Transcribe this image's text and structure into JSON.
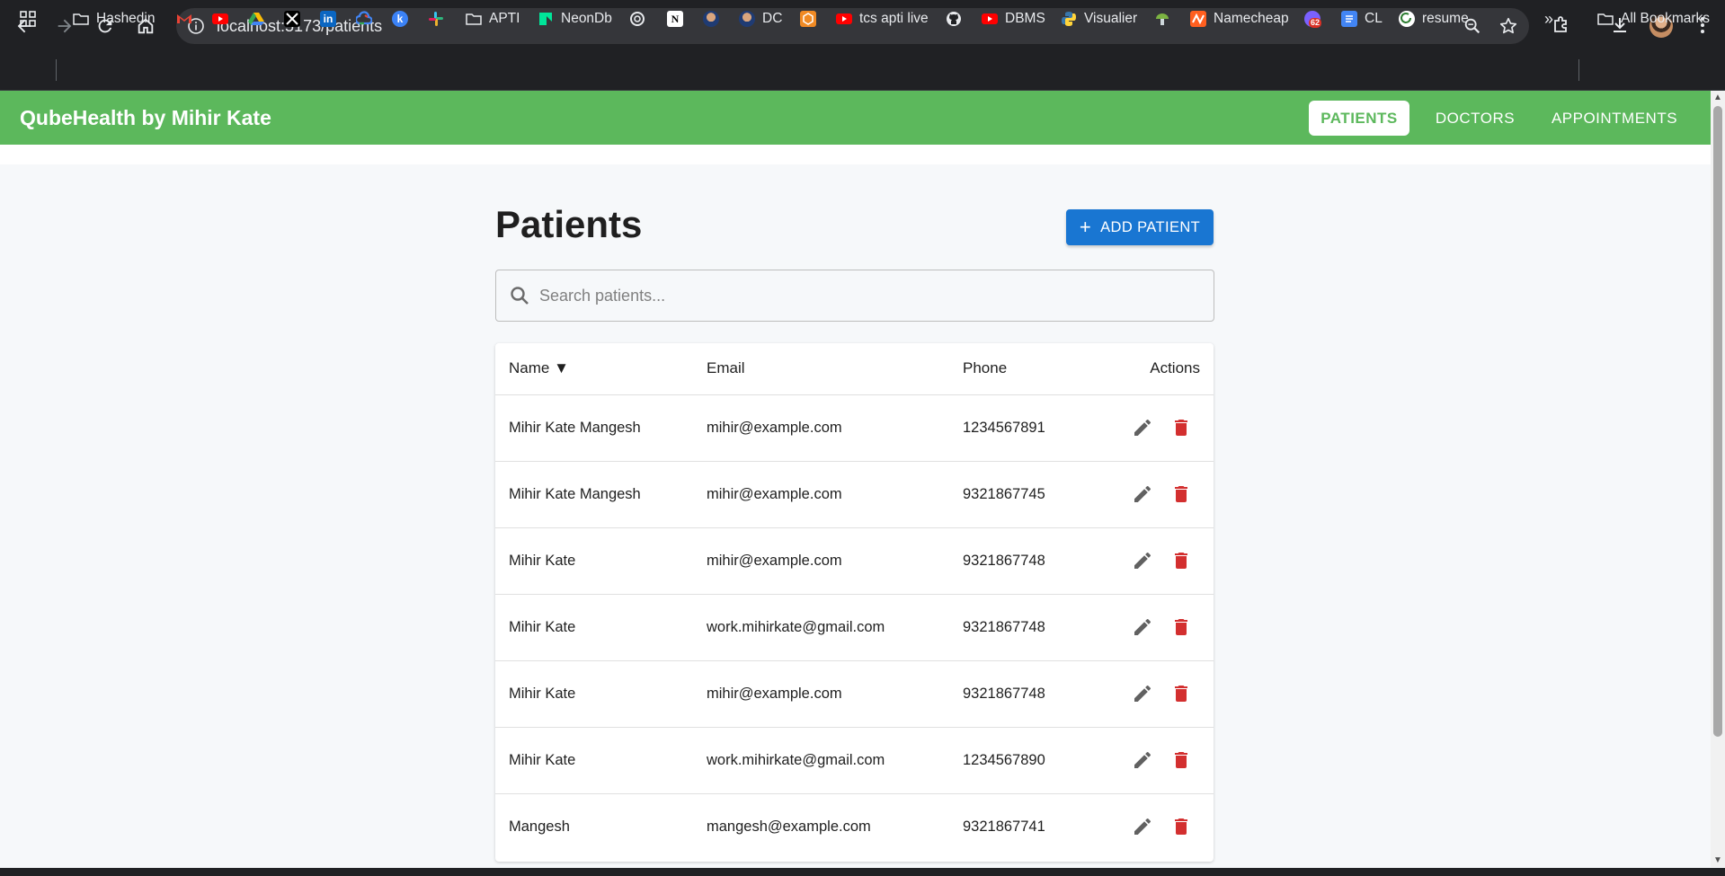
{
  "browser": {
    "url": "localhost:5173/patients",
    "bookmarks": [
      {
        "label": "Hashedin",
        "icon": "folder-icon"
      },
      {
        "label": "",
        "icon": "gmail-icon"
      },
      {
        "label": "",
        "icon": "youtube-icon"
      },
      {
        "label": "",
        "icon": "google-drive-icon"
      },
      {
        "label": "",
        "icon": "x-icon"
      },
      {
        "label": "",
        "icon": "linkedin-icon"
      },
      {
        "label": "",
        "icon": "google-cloud-icon"
      },
      {
        "label": "",
        "icon": "blue-k-icon"
      },
      {
        "label": "",
        "icon": "slack-icon"
      },
      {
        "label": "APTI",
        "icon": "folder-icon"
      },
      {
        "label": "NeonDb",
        "icon": "neon-icon"
      },
      {
        "label": "",
        "icon": "openai-icon"
      },
      {
        "label": "",
        "icon": "notion-icon"
      },
      {
        "label": "",
        "icon": "profile-icon"
      },
      {
        "label": "DC",
        "icon": "profile-icon"
      },
      {
        "label": "",
        "icon": "orange-box-icon"
      },
      {
        "label": "tcs apti live",
        "icon": "youtube-icon"
      },
      {
        "label": "",
        "icon": "github-icon"
      },
      {
        "label": "DBMS",
        "icon": "youtube-icon"
      },
      {
        "label": "Visualier",
        "icon": "python-icon"
      },
      {
        "label": "",
        "icon": "mushroom-icon"
      },
      {
        "label": "Namecheap",
        "icon": "namecheap-icon"
      },
      {
        "label": "",
        "icon": "badge-62-icon"
      },
      {
        "label": "CL",
        "icon": "docs-icon"
      },
      {
        "label": "resume",
        "icon": "resume-icon"
      }
    ],
    "all_bookmarks": "All Bookmarks",
    "badge_count": "62"
  },
  "app": {
    "brand": "QubeHealth by Mihir Kate",
    "nav": [
      {
        "label": "PATIENTS",
        "active": true
      },
      {
        "label": "DOCTORS",
        "active": false
      },
      {
        "label": "APPOINTMENTS",
        "active": false
      }
    ]
  },
  "page": {
    "title": "Patients",
    "add_button": "ADD PATIENT",
    "search_placeholder": "Search patients..."
  },
  "table": {
    "columns": [
      "Name ▼",
      "Email",
      "Phone",
      "Actions"
    ],
    "rows": [
      {
        "name": "Mihir Kate Mangesh",
        "email": "mihir@example.com",
        "phone": "1234567891"
      },
      {
        "name": "Mihir Kate Mangesh",
        "email": "mihir@example.com",
        "phone": "9321867745"
      },
      {
        "name": "Mihir Kate",
        "email": "mihir@example.com",
        "phone": "9321867748"
      },
      {
        "name": "Mihir Kate",
        "email": "work.mihirkate@gmail.com",
        "phone": "9321867748"
      },
      {
        "name": "Mihir Kate",
        "email": "mihir@example.com",
        "phone": "9321867748"
      },
      {
        "name": "Mihir Kate",
        "email": "work.mihirkate@gmail.com",
        "phone": "1234567890"
      },
      {
        "name": "Mangesh",
        "email": "mangesh@example.com",
        "phone": "9321867741"
      }
    ]
  },
  "colors": {
    "header_green": "#5cb85c",
    "primary_blue": "#1976d2",
    "delete_red": "#d32f2f",
    "edit_gray": "#616161"
  }
}
